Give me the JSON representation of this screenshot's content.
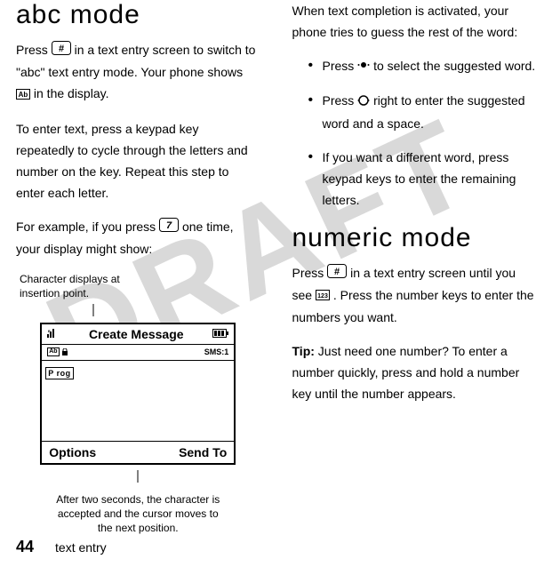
{
  "watermark": "DRAFT",
  "left": {
    "heading": "abc mode",
    "para1a": "Press ",
    "para1b": " in a text entry screen to switch to \"abc\" text entry mode. Your phone shows ",
    "para1c": " in the display.",
    "para2": "To enter text, press a keypad key repeatedly to cycle through the letters and number on the key. Repeat this step to enter each letter.",
    "para3a": "For example, if you press ",
    "para3b": " one time, your display might show:",
    "captionTop": "Character displays at insertion point.",
    "captionBottom": "After two seconds, the character is accepted and the cursor moves to the next position.",
    "screen": {
      "title": "Create Message",
      "modeLabel": "Ab",
      "sms": "SMS:1",
      "typed": "P rog",
      "leftKey": "Options",
      "rightKey": "Send To"
    }
  },
  "right": {
    "para1": "When text completion is activated, your phone tries to guess the rest of the word:",
    "bullet1a": "Press ",
    "bullet1b": " to select the suggested word.",
    "bullet2a": "Press ",
    "bullet2b": " right to enter the suggested word and a space.",
    "bullet3": "If you want a different word, press keypad keys to enter the remaining letters.",
    "heading2": "numeric mode",
    "para2a": "Press ",
    "para2b": " in a text entry screen until you see ",
    "para2c": ". Press the number keys to enter the numbers you want.",
    "tipLabel": "Tip:",
    "tipText": " Just need one number? To enter a number quickly, press and hold a number key until the number appears."
  },
  "footer": {
    "page": "44",
    "section": "text entry"
  }
}
